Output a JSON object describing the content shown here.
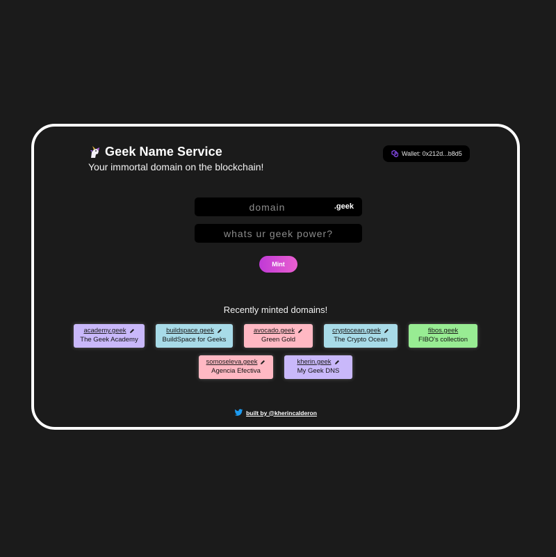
{
  "header": {
    "title": "Geek Name Service",
    "tagline": "Your immortal domain on the blockchain!",
    "icon": "unicorn-icon"
  },
  "wallet": {
    "label": "Wallet: 0x212d...b8d5",
    "icon": "polygon-icon"
  },
  "form": {
    "domain_placeholder": "domain",
    "domain_value": "",
    "tld": ".geek",
    "power_placeholder": "whats ur geek power?",
    "power_value": "",
    "mint_label": "Mint"
  },
  "recent": {
    "title": "Recently minted domains!",
    "rows": [
      [
        {
          "name": "academy.geek",
          "record": "The Geek Academy",
          "color": "#c9b8fa"
        },
        {
          "name": "buildspace.geek",
          "record": "BuildSpace for Geeks",
          "color": "#a8dbe8"
        },
        {
          "name": "avocado.geek",
          "record": "Green Gold",
          "color": "#ffb8c3"
        },
        {
          "name": "cryptocean.geek",
          "record": "The Crypto Ocean",
          "color": "#a8dbe8"
        },
        {
          "name": "fibos.geek",
          "record": "FIBO's collection",
          "color": "#98ec93"
        }
      ],
      [
        {
          "name": "somoseleva.geek",
          "record": "Agencia Efectiva",
          "color": "#ffb8c3"
        },
        {
          "name": "kherin.geek",
          "record": "My Geek DNS",
          "color": "#c9b8fa"
        }
      ]
    ]
  },
  "footer": {
    "link_text": "built by @kherincalderon",
    "icon": "twitter-icon"
  },
  "colors": {
    "background": "#1b1b1b",
    "mint_gradient_start": "#c03ad6",
    "mint_gradient_end": "#e95fd0",
    "twitter_blue": "#1d9bf0",
    "polygon_purple": "#8247e5"
  }
}
